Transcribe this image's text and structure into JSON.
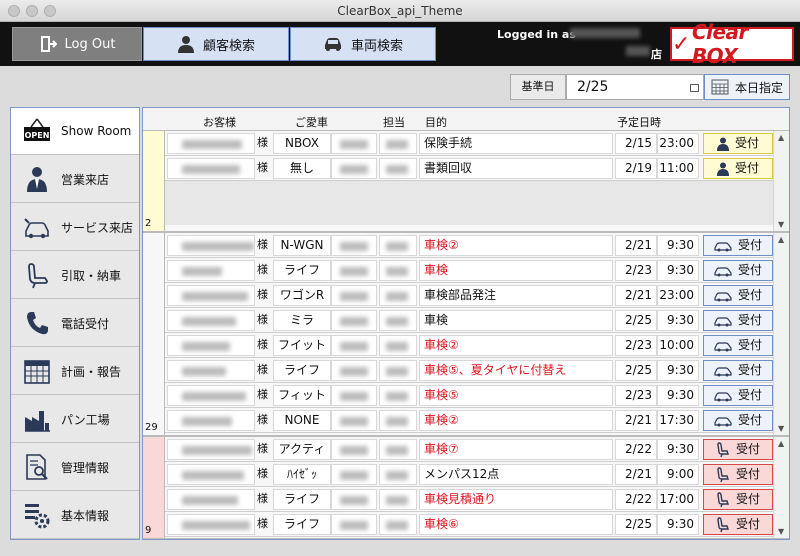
{
  "window": {
    "title": "ClearBox_api_Theme"
  },
  "header": {
    "logout_label": "Log Out",
    "customer_search_label": "顧客検索",
    "vehicle_search_label": "車両検索",
    "logged_in_label": "Logged in as",
    "store_suffix": "店",
    "logo_text": "Clear BOX",
    "logo_color": "#d2191e"
  },
  "datebar": {
    "label": "基準日",
    "value": "2/25",
    "today_label": "本日指定"
  },
  "sidebar": {
    "items": [
      {
        "label": "Show Room",
        "icon": "open-sign-icon"
      },
      {
        "label": "営業来店",
        "icon": "salesperson-icon"
      },
      {
        "label": "サービス来店",
        "icon": "car-service-icon"
      },
      {
        "label": "引取・納車",
        "icon": "car-seat-icon"
      },
      {
        "label": "電話受付",
        "icon": "phone-icon"
      },
      {
        "label": "計画・報告",
        "icon": "calendar-icon"
      },
      {
        "label": "パン工場",
        "icon": "factory-icon"
      },
      {
        "label": "管理情報",
        "icon": "document-search-icon"
      },
      {
        "label": "基本情報",
        "icon": "settings-gear-icon"
      }
    ]
  },
  "table": {
    "headers": {
      "customer": "お客様",
      "car": "ご愛車",
      "staff": "担当",
      "purpose": "目的",
      "scheduled": "予定日時"
    },
    "honorific": "様",
    "receive_label": "受付",
    "groups": [
      {
        "count": "2",
        "color": "#fffbd3",
        "button_style": "yellow",
        "rows": [
          {
            "car": "NBOX",
            "purpose": "保険手続",
            "purpose_red": false,
            "date": "2/15",
            "time": "23:00"
          },
          {
            "car": "無し",
            "purpose": "書類回収",
            "purpose_red": false,
            "date": "2/19",
            "time": "11:00"
          }
        ]
      },
      {
        "count": "29",
        "color": "#f7f7f7",
        "button_style": "blue",
        "rows": [
          {
            "car": "N-WGN",
            "purpose": "車検②",
            "purpose_red": true,
            "date": "2/21",
            "time": "9:30"
          },
          {
            "car": "ライフ",
            "purpose": "車検",
            "purpose_red": true,
            "date": "2/23",
            "time": "9:30"
          },
          {
            "car": "ワゴンR",
            "purpose": "車検部品発注",
            "purpose_red": false,
            "date": "2/21",
            "time": "23:00"
          },
          {
            "car": "ミラ",
            "purpose": "車検",
            "purpose_red": false,
            "date": "2/25",
            "time": "9:30"
          },
          {
            "car": "フイット",
            "purpose": "車検②",
            "purpose_red": true,
            "date": "2/23",
            "time": "10:00"
          },
          {
            "car": "ライフ",
            "purpose": "車検⑤、夏タイヤに付替え",
            "purpose_red": true,
            "date": "2/25",
            "time": "9:30"
          },
          {
            "car": "フィット",
            "purpose": "車検⑤",
            "purpose_red": true,
            "date": "2/23",
            "time": "9:30"
          },
          {
            "car": "NONE",
            "purpose": "車検②",
            "purpose_red": true,
            "date": "2/21",
            "time": "17:30"
          }
        ]
      },
      {
        "count": "9",
        "color": "#fbd8d8",
        "button_style": "red",
        "rows": [
          {
            "car": "アクティ",
            "purpose": "車検⑦",
            "purpose_red": true,
            "date": "2/22",
            "time": "9:30"
          },
          {
            "car": "ﾊｲｾﾞｯ",
            "purpose": "メンパス12点",
            "purpose_red": false,
            "date": "2/21",
            "time": "9:00"
          },
          {
            "car": "ライフ",
            "purpose": "車検見積通り",
            "purpose_red": true,
            "date": "2/22",
            "time": "17:00"
          },
          {
            "car": "ライフ",
            "purpose": "車検⑥",
            "purpose_red": true,
            "date": "2/25",
            "time": "9:30"
          }
        ]
      }
    ]
  }
}
